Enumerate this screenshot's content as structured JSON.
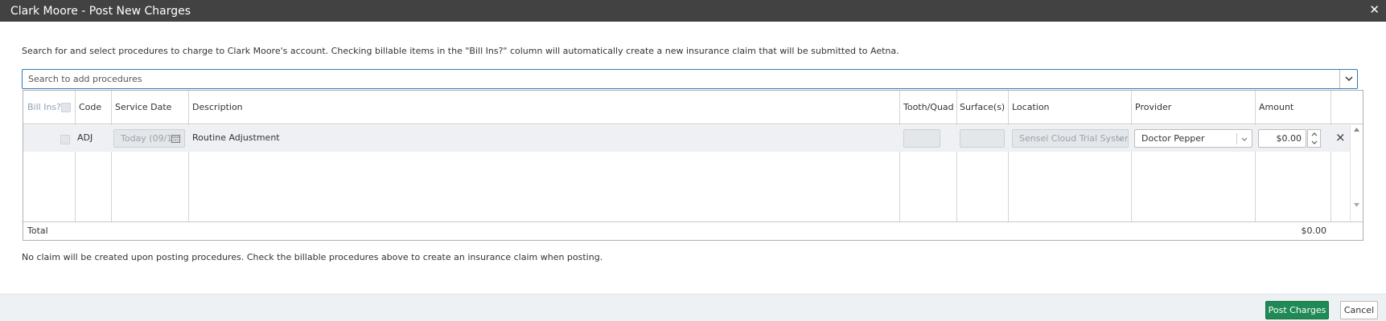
{
  "dialog": {
    "title": "Clark Moore - Post New Charges",
    "close_glyph": "✕"
  },
  "instructions": "Search for and select procedures to charge to Clark Moore's account. Checking billable items in the \"Bill Ins?\" column will automatically create a new insurance claim that will be submitted to Aetna.",
  "search": {
    "placeholder": "Search to add procedures",
    "value": ""
  },
  "table": {
    "columns": [
      "Bill Ins?",
      "Code",
      "Service Date",
      "Description",
      "Tooth/Quad",
      "Surface(s)",
      "Location",
      "Provider",
      "Amount"
    ],
    "rows": [
      {
        "bill_ins": false,
        "code": "ADJ",
        "service_date": "Today (09/1",
        "description": "Routine Adjustment",
        "tooth_quad": "",
        "surfaces": "",
        "location": "Sensei Cloud Trial Syster",
        "provider": "Doctor Pepper",
        "amount": "$0.00"
      }
    ],
    "footer": {
      "label": "Total",
      "amount": "$0.00"
    }
  },
  "footer_note": "No claim will be created upon posting procedures. Check the billable procedures above to create an insurance claim when posting.",
  "buttons": {
    "post": "Post Charges",
    "cancel": "Cancel"
  },
  "icons": {
    "delete_row": "×",
    "calendar": "calendar-icon",
    "chevron": "chevron-down-icon"
  },
  "colors": {
    "titlebar": "#424242",
    "accent_blue": "#2e7ab8",
    "primary_button": "#1f8a55"
  }
}
